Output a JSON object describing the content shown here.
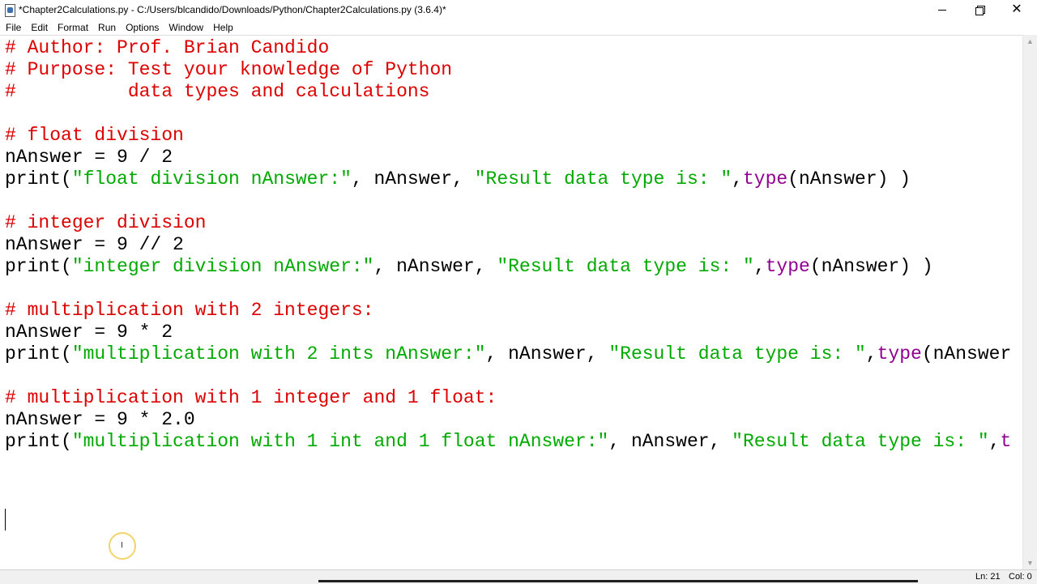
{
  "window": {
    "title": "*Chapter2Calculations.py - C:/Users/blcandido/Downloads/Python/Chapter2Calculations.py (3.6.4)*",
    "icon": "python-idle-icon",
    "controls": {
      "minimize": "minimize-icon",
      "maximize": "restore-icon",
      "close": "✕"
    }
  },
  "menu": [
    "File",
    "Edit",
    "Format",
    "Run",
    "Options",
    "Window",
    "Help"
  ],
  "editor": {
    "lines": [
      [
        {
          "t": "cm",
          "v": "# Author: Prof. Brian Candido"
        }
      ],
      [
        {
          "t": "cm",
          "v": "# Purpose: Test your knowledge of Python"
        }
      ],
      [
        {
          "t": "cm",
          "v": "#          data types and calculations"
        }
      ],
      [],
      [
        {
          "t": "cm",
          "v": "# float division"
        }
      ],
      [
        {
          "t": "",
          "v": "nAnswer = 9 / 2"
        }
      ],
      [
        {
          "t": "",
          "v": "print("
        },
        {
          "t": "st",
          "v": "\"float division nAnswer:\""
        },
        {
          "t": "",
          "v": ", nAnswer, "
        },
        {
          "t": "st",
          "v": "\"Result data type is: \""
        },
        {
          "t": "",
          "v": ","
        },
        {
          "t": "bi",
          "v": "type"
        },
        {
          "t": "",
          "v": "(nAnswer) )"
        }
      ],
      [],
      [
        {
          "t": "cm",
          "v": "# integer division"
        }
      ],
      [
        {
          "t": "",
          "v": "nAnswer = 9 // 2"
        }
      ],
      [
        {
          "t": "",
          "v": "print("
        },
        {
          "t": "st",
          "v": "\"integer division nAnswer:\""
        },
        {
          "t": "",
          "v": ", nAnswer, "
        },
        {
          "t": "st",
          "v": "\"Result data type is: \""
        },
        {
          "t": "",
          "v": ","
        },
        {
          "t": "bi",
          "v": "type"
        },
        {
          "t": "",
          "v": "(nAnswer) )"
        }
      ],
      [],
      [
        {
          "t": "cm",
          "v": "# multiplication with 2 integers:"
        }
      ],
      [
        {
          "t": "",
          "v": "nAnswer = 9 * 2"
        }
      ],
      [
        {
          "t": "",
          "v": "print("
        },
        {
          "t": "st",
          "v": "\"multiplication with 2 ints nAnswer:\""
        },
        {
          "t": "",
          "v": ", nAnswer, "
        },
        {
          "t": "st",
          "v": "\"Result data type is: \""
        },
        {
          "t": "",
          "v": ","
        },
        {
          "t": "bi",
          "v": "type"
        },
        {
          "t": "",
          "v": "(nAnswer"
        }
      ],
      [],
      [
        {
          "t": "cm",
          "v": "# multiplication with 1 integer and 1 float:"
        }
      ],
      [
        {
          "t": "",
          "v": "nAnswer = 9 * 2.0"
        }
      ],
      [
        {
          "t": "",
          "v": "print("
        },
        {
          "t": "st",
          "v": "\"multiplication with 1 int and 1 float nAnswer:\""
        },
        {
          "t": "",
          "v": ", nAnswer, "
        },
        {
          "t": "st",
          "v": "\"Result data type is: \""
        },
        {
          "t": "",
          "v": ","
        },
        {
          "t": "bi",
          "v": "t"
        }
      ],
      [],
      []
    ],
    "colors": {
      "comment": "#dd0000",
      "string": "#00aa00",
      "builtin": "#900090",
      "default": "#000000"
    }
  },
  "status": {
    "line": "Ln: 21",
    "col": "Col: 0"
  }
}
